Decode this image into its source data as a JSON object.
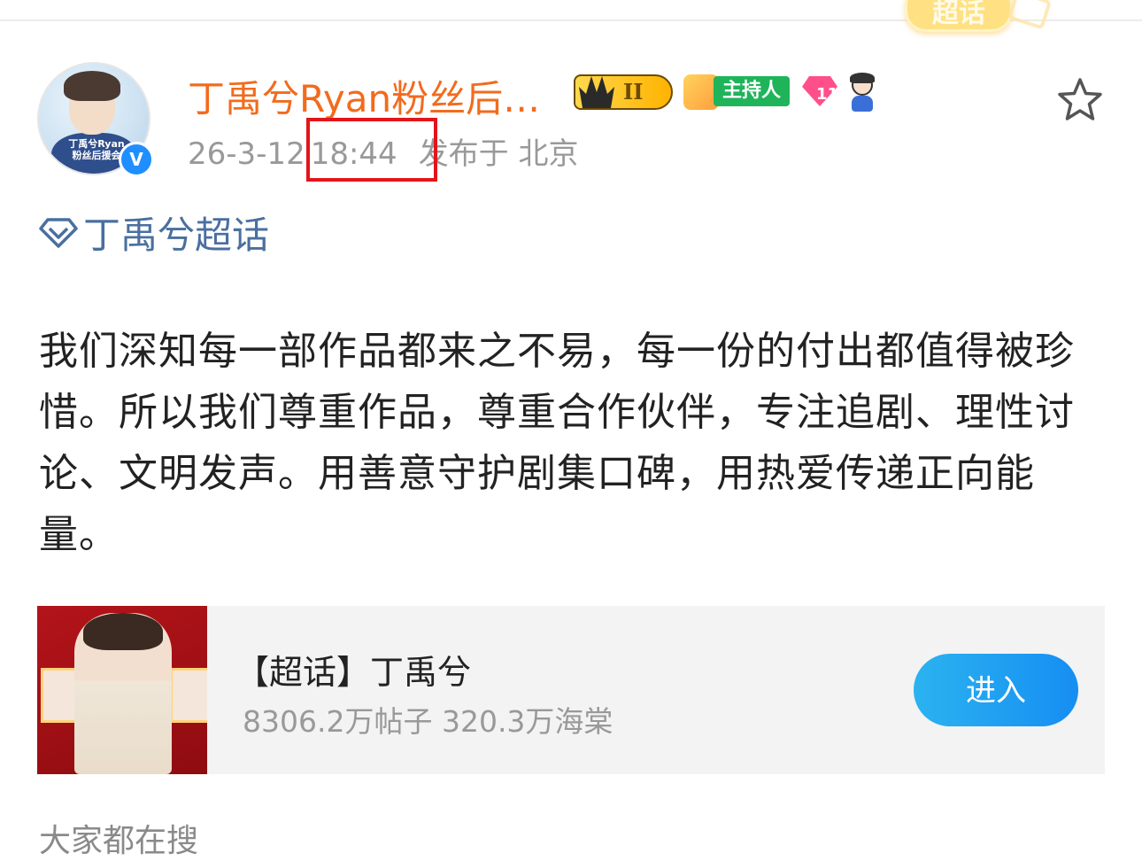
{
  "colors": {
    "username": "#f26b1d",
    "meta_text": "#999999",
    "topic_link": "#4a6fa0",
    "highlight_box": "#e3141b",
    "enter_button": "#168ef2",
    "host_badge": "#1fb45a"
  },
  "corner_badge": {
    "label": "超话"
  },
  "post": {
    "author": {
      "avatar_caption": "丁禹兮Ryan 粉丝后援会",
      "verified_mark": "V",
      "name": "丁禹兮Ryan粉丝后…",
      "badges": {
        "level_label": "II",
        "host_label": "主持人",
        "gem_level": "11"
      }
    },
    "meta": {
      "date": "26-3-12",
      "time": "18:44",
      "location": "发布于 北京"
    },
    "topic_tag": "丁禹兮超话",
    "body": "我们深知每一部作品都来之不易，每一份的付出都值得被珍惜。所以我们尊重作品，尊重合作伙伴，专注追剧、理性讨论、文明发声。用善意守护剧集口碑，用热爱传递正向能量。",
    "favorite_icon": "star-outline-icon"
  },
  "topic_card": {
    "title": "【超话】丁禹兮",
    "stats": "8306.2万帖子 320.3万海棠",
    "enter_label": "进入"
  },
  "trending": {
    "label": "大家都在搜"
  }
}
